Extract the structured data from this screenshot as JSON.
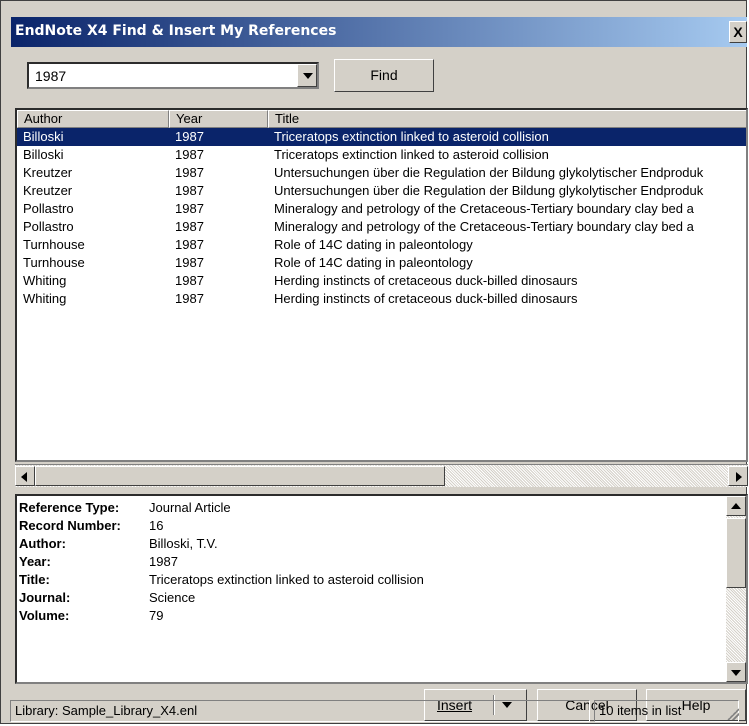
{
  "window": {
    "title": "EndNote X4 Find & Insert My References",
    "close_label": "X"
  },
  "search": {
    "value": "1987",
    "find_label": "Find"
  },
  "list": {
    "columns": [
      "Author",
      "Year",
      "Title"
    ],
    "rows": [
      {
        "author": "Billoski",
        "year": "1987",
        "title": "Triceratops extinction linked to asteroid collision",
        "selected": true
      },
      {
        "author": "Billoski",
        "year": "1987",
        "title": "Triceratops extinction linked to asteroid collision"
      },
      {
        "author": "Kreutzer",
        "year": "1987",
        "title": "Untersuchungen über die Regulation der Bildung glykolytischer Endproduk"
      },
      {
        "author": "Kreutzer",
        "year": "1987",
        "title": "Untersuchungen über die Regulation der Bildung glykolytischer Endproduk"
      },
      {
        "author": "Pollastro",
        "year": "1987",
        "title": "Mineralogy and petrology of the Cretaceous-Tertiary boundary clay bed a"
      },
      {
        "author": "Pollastro",
        "year": "1987",
        "title": "Mineralogy and petrology of the Cretaceous-Tertiary boundary clay bed a"
      },
      {
        "author": "Turnhouse",
        "year": "1987",
        "title": "Role of 14C dating in paleontology"
      },
      {
        "author": "Turnhouse",
        "year": "1987",
        "title": "Role of 14C dating in paleontology"
      },
      {
        "author": "Whiting",
        "year": "1987",
        "title": "Herding instincts of cretaceous duck-billed dinosaurs"
      },
      {
        "author": "Whiting",
        "year": "1987",
        "title": "Herding instincts of cretaceous duck-billed dinosaurs"
      }
    ]
  },
  "details": [
    {
      "label": "Reference Type:",
      "value": "Journal Article"
    },
    {
      "label": "Record Number:",
      "value": "16"
    },
    {
      "label": "Author:",
      "value": "Billoski, T.V."
    },
    {
      "label": "Year:",
      "value": "1987"
    },
    {
      "label": "Title:",
      "value": "Triceratops extinction linked to asteroid collision"
    },
    {
      "label": "Journal:",
      "value": "Science"
    },
    {
      "label": "Volume:",
      "value": "79"
    }
  ],
  "buttons": {
    "insert": "Insert",
    "cancel": "Cancel",
    "help": "Help"
  },
  "status": {
    "library": "Library: Sample_Library_X4.enl",
    "count": "10 items in list"
  },
  "colors": {
    "titlebar": "#0a246a",
    "selection": "#0a246a",
    "chrome": "#d4d0c8"
  }
}
